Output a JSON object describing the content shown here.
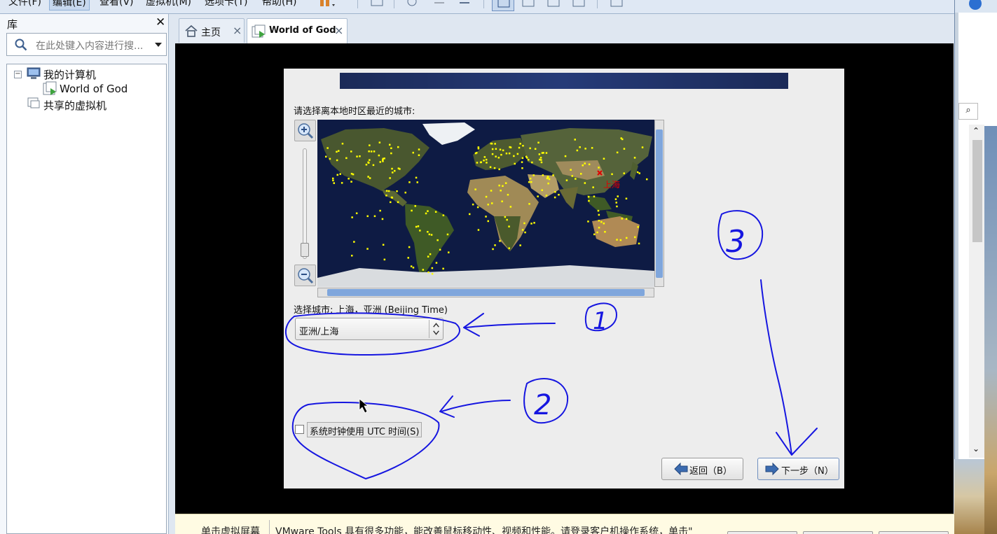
{
  "menubar": {
    "items": [
      "文件(F)",
      "编辑(E)",
      "查看(V)",
      "虚拟机(M)",
      "选项卡(T)",
      "帮助(H)"
    ],
    "active_item": "编辑(E)"
  },
  "library": {
    "title": "库",
    "search_placeholder": "在此处键入内容进行搜...",
    "tree": {
      "my_computer": "我的计算机",
      "vm": "World of God",
      "shared_vms": "共享的虚拟机"
    }
  },
  "tabs": [
    {
      "label": "主页",
      "icon": "home-icon"
    },
    {
      "label": "World of God",
      "icon": "vm-play-icon",
      "active": true
    }
  ],
  "installer": {
    "prompt": "请选择离本地时区最近的城市:",
    "map_city_marker": "上海",
    "selected_city_label": "选择城市: 上海，亚洲 (Beijing Time)",
    "timezone_value": "亚洲/上海",
    "utc_checkbox_label": "系统时钟使用 UTC 时间(S)",
    "utc_checked": false,
    "back_button": "返回（B）",
    "next_button": "下一步（N）"
  },
  "annotations": {
    "circle_1": "1",
    "circle_2": "2",
    "circle_3": "3",
    "ink_color": "#1616e0"
  },
  "bottom_bar": {
    "left_text": "单击虚拟屏幕",
    "message": "VMware Tools 具有很多功能，能改善鼠标移动性、视频和性能。请登录客户机操作系统，单击\""
  },
  "colors": {
    "accent": "#7fa6dc",
    "city_dot": "#ffff00",
    "selected_city": "#e00000",
    "map_ocean": "#0e1b44"
  }
}
